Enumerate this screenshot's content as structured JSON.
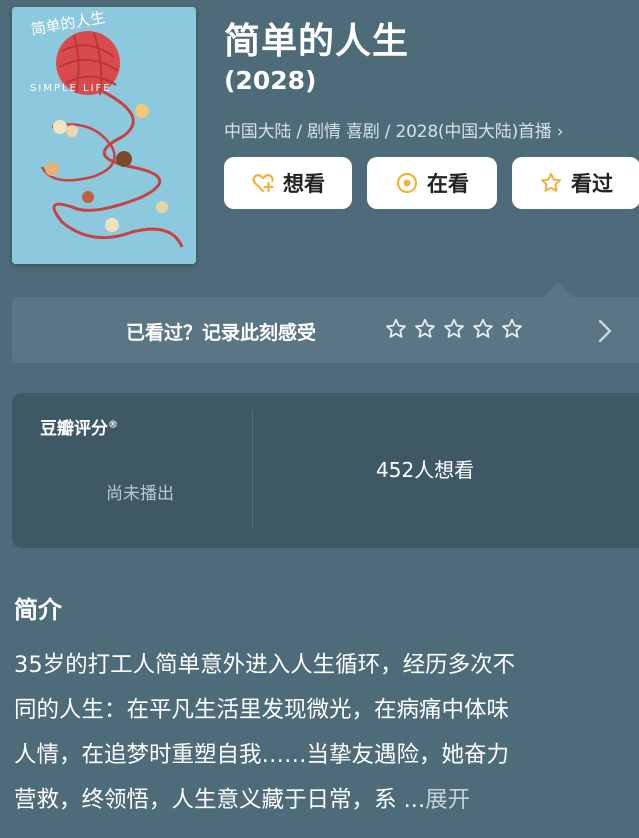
{
  "movie": {
    "title": "简单的人生",
    "year": "(2028)",
    "meta": "中国大陆 / 剧情 喜剧 / 2028(中国大陆)首播 ›"
  },
  "poster": {
    "title_text": "简单的人生",
    "subtitle_text": "SIMPLE LIFE"
  },
  "actions": [
    {
      "label": "想看",
      "icon": "heart-plus-icon"
    },
    {
      "label": "在看",
      "icon": "target-icon"
    },
    {
      "label": "看过",
      "icon": "star-icon"
    }
  ],
  "rating_prompt": {
    "text": "已看过？记录此刻感受",
    "stars": 5,
    "stars_filled": 0
  },
  "score": {
    "label": "豆瓣评分",
    "trademark": "®",
    "status": "尚未播出",
    "want_count": "452人想看"
  },
  "synopsis": {
    "heading": "简介",
    "lines": [
      "35岁的打工人简单意外进入人生循环，经历多次不",
      "同的人生：在平凡生活里发现微光，在病痛中体味",
      "人情，在追梦时重塑自我……当挚友遇险，她奋力",
      "营救，终领悟，人生意义藏于日常，系 ..."
    ],
    "expand_label": "展开"
  },
  "colors": {
    "background": "#4e6b79",
    "card": "#3e5866",
    "rate_bar": "#5a7684",
    "accent": "#f2b33d"
  }
}
